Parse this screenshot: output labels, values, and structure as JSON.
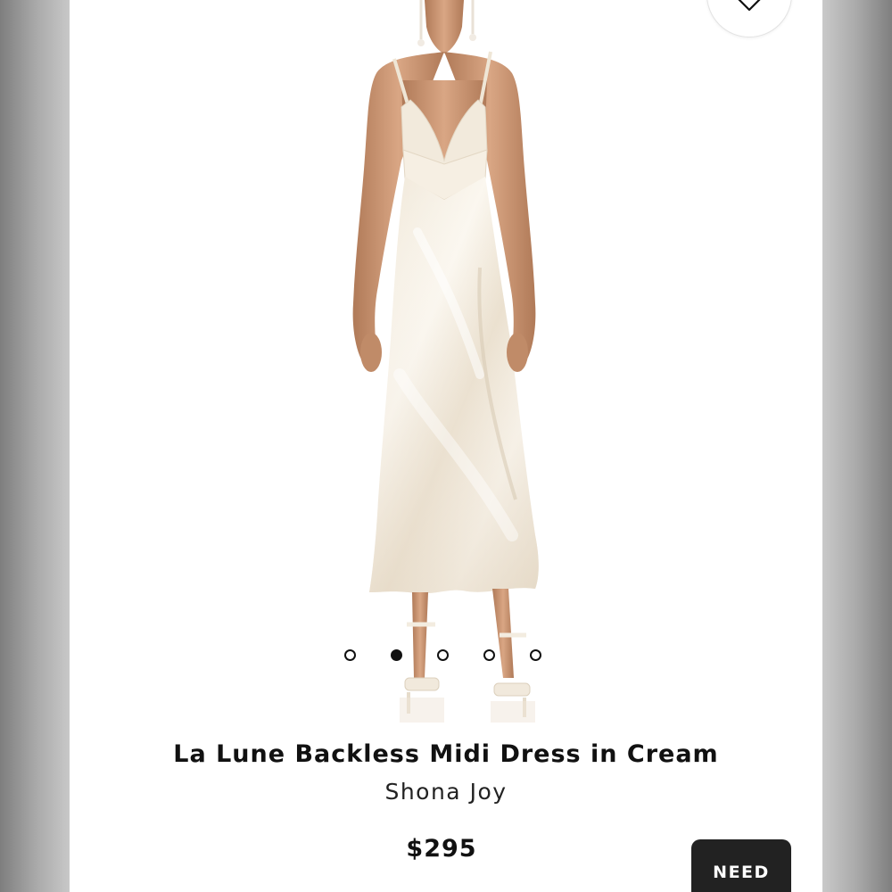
{
  "product": {
    "title": "La Lune Backless Midi Dress in Cream",
    "brand": "Shona Joy",
    "price": "$295"
  },
  "carousel": {
    "total_images": 5,
    "active_index": 1
  },
  "help_button": {
    "label": "NEED HELP?"
  },
  "icons": {
    "wishlist": "heart-icon"
  },
  "colors": {
    "text": "#111111",
    "dress": "#f3ecdf",
    "help_button_bg": "#222222"
  }
}
